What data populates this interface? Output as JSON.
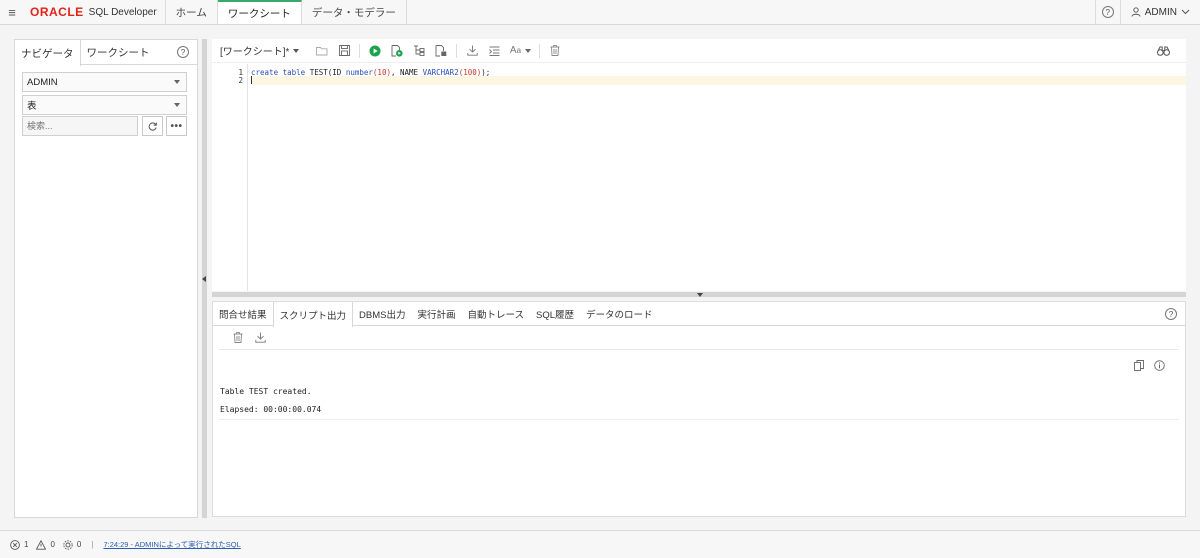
{
  "topbar": {
    "brand_oracle": "ORACLE",
    "brand_product": "SQL Developer",
    "tabs": [
      {
        "label": "ホーム"
      },
      {
        "label": "ワークシート"
      },
      {
        "label": "データ・モデラー"
      }
    ],
    "active_tab": "ワークシート",
    "user": "ADMIN"
  },
  "navigator": {
    "tabs": [
      {
        "label": "ナビゲータ"
      },
      {
        "label": "ワークシート"
      }
    ],
    "schema_select": "ADMIN",
    "object_type_select": "表",
    "search_placeholder": "検索..."
  },
  "editor": {
    "worksheet_label": "[ワークシート]*",
    "line_numbers": [
      "1",
      "2"
    ],
    "code": {
      "kw_create": "create",
      "kw_table": "table",
      "name": "TEST(ID",
      "type1": "number",
      "num1": "(10)",
      "mid": ", NAME",
      "type2": "VARCHAR2",
      "num2": "(100)",
      "end": ");"
    }
  },
  "output": {
    "tabs": [
      {
        "label": "問合せ結果"
      },
      {
        "label": "スクリプト出力"
      },
      {
        "label": "DBMS出力"
      },
      {
        "label": "実行計画"
      },
      {
        "label": "自動トレース"
      },
      {
        "label": "SQL履歴"
      },
      {
        "label": "データのロード"
      }
    ],
    "active_tab": "スクリプト出力",
    "line1": "Table TEST created.",
    "line2": "Elapsed: 00:00:00.074"
  },
  "statusbar": {
    "errors": "1",
    "warnings": "0",
    "tasks": "0",
    "message": "7:24:29 - ADMINによって実行されたSQL"
  },
  "colors": {
    "oracle_red": "#e2231a",
    "run_green": "#1aa34a",
    "active_tab_accent": "#3aa76d",
    "keyword_blue": "#2b4fb8",
    "link_blue": "#2a5db0"
  }
}
